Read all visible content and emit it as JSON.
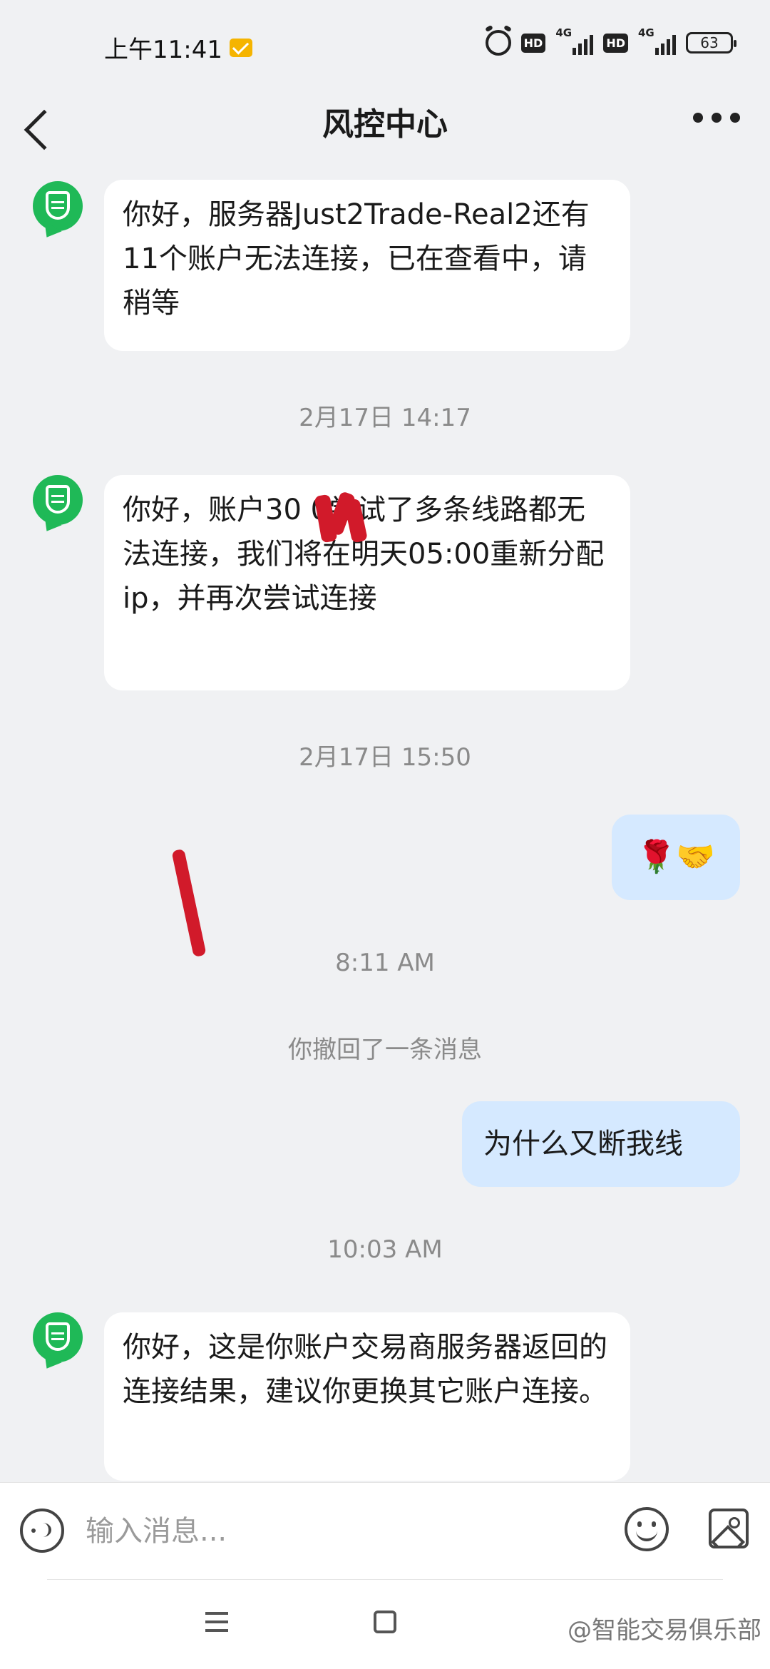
{
  "status_bar": {
    "time": "上午11:41",
    "network_1": "4G",
    "network_2": "4G",
    "hd_1": "HD",
    "hd_2": "HD",
    "battery": "63"
  },
  "header": {
    "title": "风控中心"
  },
  "messages": [
    {
      "type": "incoming",
      "text": "你好，服务器Just2Trade-Real2还有11个账户无法连接，已在查看中，请稍等"
    },
    {
      "type": "timestamp",
      "text": "2月17日 14:17"
    },
    {
      "type": "incoming",
      "text": "你好，账户30  0尝试了多条线路都无法连接，我们将在明天05:00重新分配ip，并再次尝试连接"
    },
    {
      "type": "timestamp",
      "text": "2月17日 15:50"
    },
    {
      "type": "outgoing",
      "text": "🌹🤝"
    },
    {
      "type": "timestamp",
      "text": "8:11 AM"
    },
    {
      "type": "system",
      "text": "你撤回了一条消息"
    },
    {
      "type": "outgoing",
      "text": "为什么又断我线"
    },
    {
      "type": "timestamp",
      "text": "10:03 AM"
    },
    {
      "type": "incoming",
      "text": "你好，这是你账户交易商服务器返回的连接结果，建议你更换其它账户连接。"
    }
  ],
  "input_bar": {
    "placeholder": "输入消息..."
  },
  "nav_bar": {
    "watermark": "@智能交易俱乐部"
  },
  "colors": {
    "avatar_green": "#1fb957",
    "outgoing_bubble": "#d5e9ff",
    "background": "#f0f1f3",
    "scribble_red": "#d11a2a"
  }
}
